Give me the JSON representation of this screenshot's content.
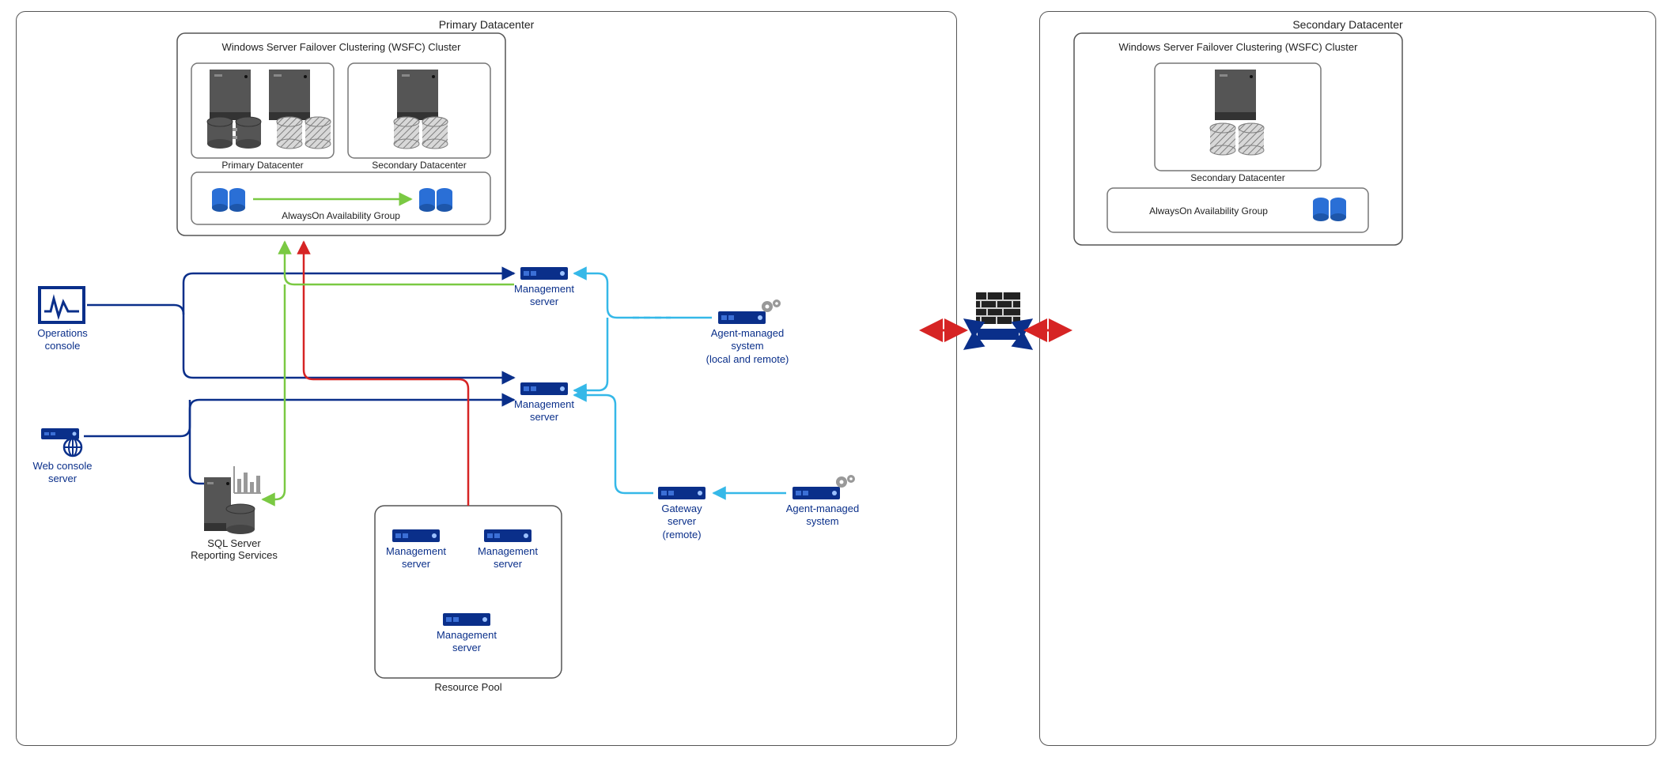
{
  "primary": {
    "title": "Primary Datacenter",
    "wsfc_title": "Windows Server Failover Clustering (WSFC) Cluster",
    "wsfc_primary_label": "Primary Datacenter",
    "wsfc_secondary_label": "Secondary Datacenter",
    "aoag_label": "AlwaysOn Availability Group",
    "operations_console": "Operations\nconsole",
    "web_console": "Web console\nserver",
    "sql_reporting": "SQL Server\nReporting Services",
    "mgmt_server_1": "Management\nserver",
    "mgmt_server_2": "Management\nserver",
    "agent_managed_local": "Agent-managed\nsystem\n(local and remote)",
    "gateway_server": "Gateway\nserver\n(remote)",
    "agent_managed": "Agent-managed\nsystem",
    "resource_pool": {
      "title": "Resource Pool",
      "mgmt_a": "Management\nserver",
      "mgmt_b": "Management\nserver",
      "mgmt_c": "Management\nserver"
    }
  },
  "secondary": {
    "title": "Secondary Datacenter",
    "wsfc_title": "Windows Server Failover Clustering (WSFC) Cluster",
    "wsfc_secondary_label": "Secondary Datacenter",
    "aoag_label": "AlwaysOn Availability Group"
  },
  "colors": {
    "navy": "#0a2f8a",
    "light_blue": "#35b8e8",
    "green": "#7ac943",
    "red": "#d62424",
    "grey": "#555555",
    "hatch_grey": "#9e9e9e"
  }
}
